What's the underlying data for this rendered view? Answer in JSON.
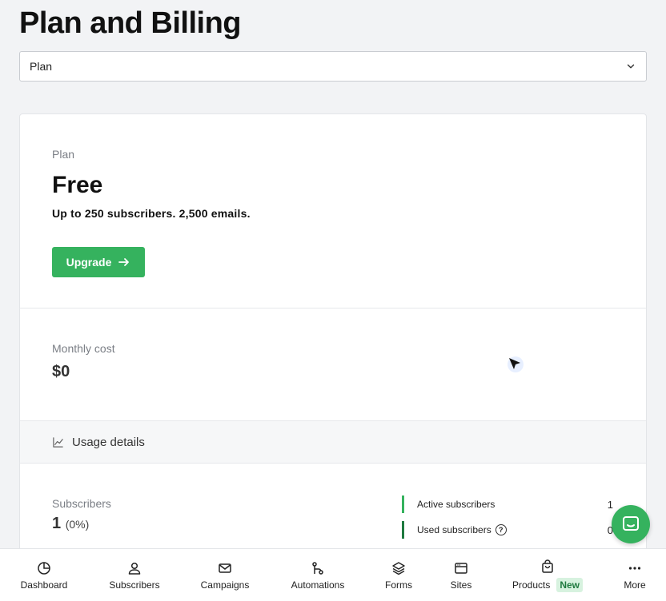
{
  "page": {
    "title": "Plan and Billing"
  },
  "section_select": {
    "value": "Plan"
  },
  "plan": {
    "label": "Plan",
    "name": "Free",
    "description": "Up to 250 subscribers. 2,500 emails.",
    "upgrade_label": "Upgrade"
  },
  "cost": {
    "label": "Monthly cost",
    "value": "$0"
  },
  "usage": {
    "header": "Usage details",
    "subscribers_label": "Subscribers",
    "subscribers_count": "1",
    "subscribers_percent": "(0%)",
    "stats": [
      {
        "label": "Active subscribers",
        "value": "1"
      },
      {
        "label": "Used subscribers",
        "value": "0"
      }
    ]
  },
  "nav": {
    "items": [
      {
        "label": "Dashboard",
        "icon": "pie-chart-icon"
      },
      {
        "label": "Subscribers",
        "icon": "user-icon"
      },
      {
        "label": "Campaigns",
        "icon": "mail-icon"
      },
      {
        "label": "Automations",
        "icon": "workflow-icon"
      },
      {
        "label": "Forms",
        "icon": "layers-icon"
      },
      {
        "label": "Sites",
        "icon": "browser-icon"
      },
      {
        "label": "Products",
        "icon": "bag-icon",
        "badge": "New"
      },
      {
        "label": "More",
        "icon": "ellipsis-icon"
      }
    ]
  },
  "colors": {
    "accent": "#35b25e",
    "accent_dark": "#1f7a3f",
    "badge_bg": "#d7f2df"
  }
}
